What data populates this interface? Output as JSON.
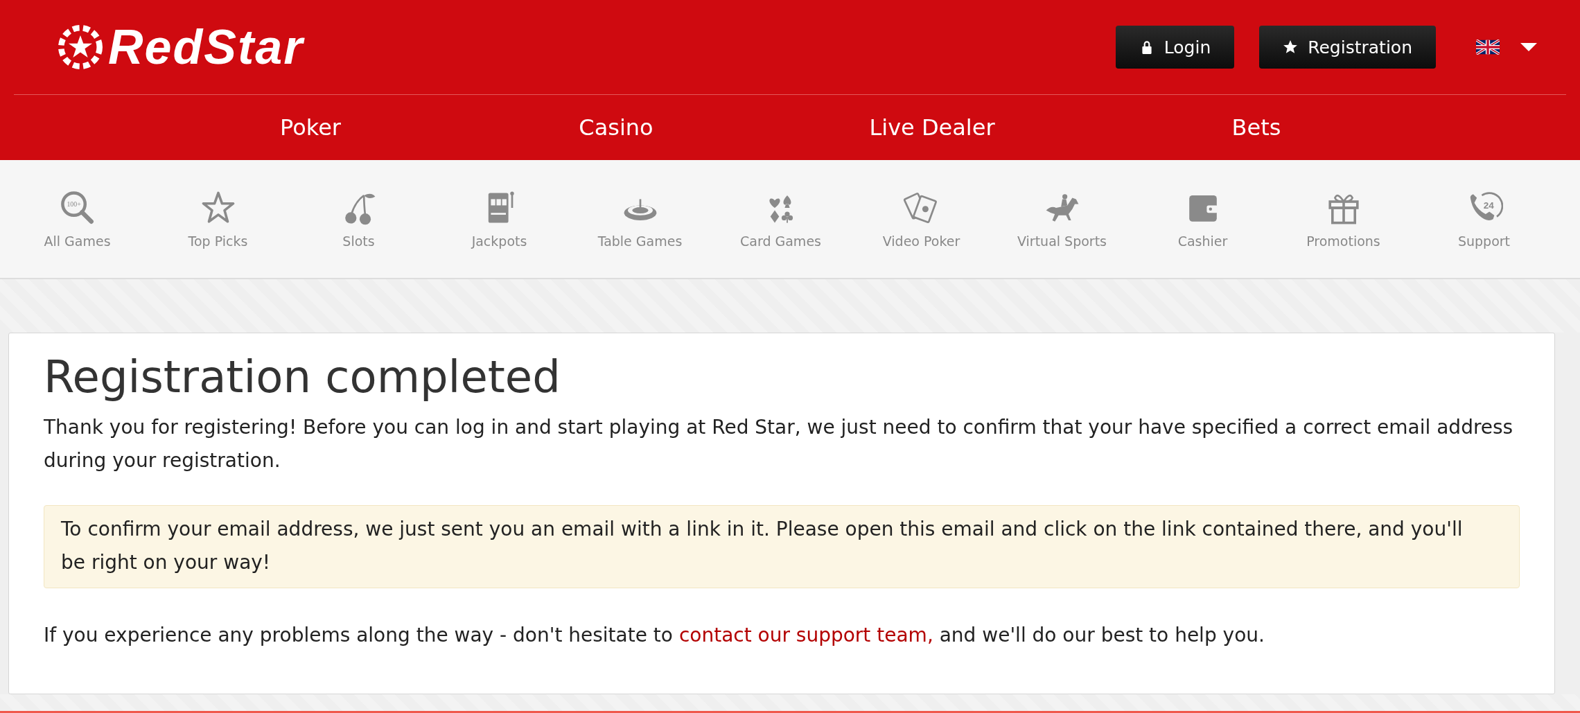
{
  "header": {
    "logo": "RedStar",
    "buttons": [
      {
        "kind": "lock",
        "label": "Login"
      },
      {
        "kind": "star",
        "label": "Registration"
      }
    ],
    "language": {
      "kind": "uk"
    }
  },
  "main_nav": [
    "Poker",
    "Casino",
    "Live Dealer",
    "Bets"
  ],
  "category_nav": [
    {
      "kind": "search",
      "label": "All Games",
      "icon_text": "100+"
    },
    {
      "kind": "star",
      "label": "Top Picks"
    },
    {
      "kind": "cherry",
      "label": "Slots"
    },
    {
      "kind": "slot",
      "label": "Jackpots"
    },
    {
      "kind": "roulette",
      "label": "Table Games"
    },
    {
      "kind": "suits",
      "label": "Card Games"
    },
    {
      "kind": "cards",
      "label": "Video Poker"
    },
    {
      "kind": "horse",
      "label": "Virtual Sports"
    },
    {
      "kind": "wallet",
      "label": "Cashier"
    },
    {
      "kind": "gift",
      "label": "Promotions"
    },
    {
      "kind": "phone",
      "label": "Support",
      "icon_text": "24"
    }
  ],
  "content": {
    "title": "Registration completed",
    "intro": "Thank you for registering! Before you can log in and start playing at Red Star, we just need to confirm that your have specified a correct email address during your registration.",
    "notice": "To confirm your email address, we just sent you an email with a link in it. Please open this email and click on the link contained there, and you'll be right on your way!",
    "help": {
      "before": "If you experience any problems along the way - don't hesitate to ",
      "link": "contact our support team,",
      "after": " and we'll do our best to help you."
    }
  }
}
